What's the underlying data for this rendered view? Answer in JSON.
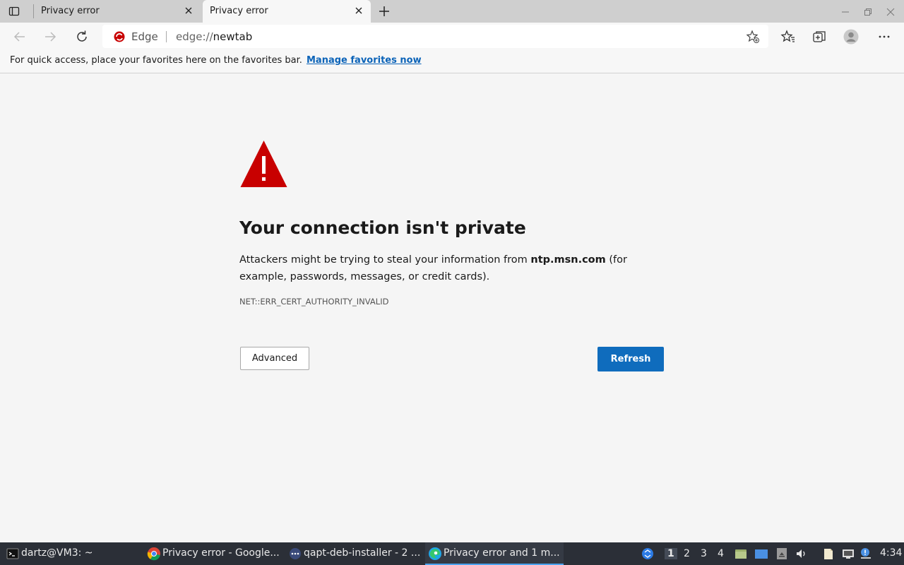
{
  "tabs": [
    {
      "title": "Privacy error",
      "active": false
    },
    {
      "title": "Privacy error",
      "active": true
    }
  ],
  "omnibox": {
    "label": "Edge",
    "url_scheme": "edge://",
    "url_host": "newtab"
  },
  "favorites_bar": {
    "message": "For quick access, place your favorites here on the favorites bar.",
    "link": "Manage favorites now"
  },
  "error_page": {
    "heading": "Your connection isn't private",
    "desc_before": "Attackers might be trying to steal your information from ",
    "desc_host": "ntp.msn.com",
    "desc_after": " (for example, passwords, messages, or credit cards).",
    "error_code": "NET::ERR_CERT_AUTHORITY_INVALID",
    "advanced_label": "Advanced",
    "refresh_label": "Refresh"
  },
  "taskbar": {
    "tasks": [
      {
        "label": "dartz@VM3: ~",
        "icon": "terminal-icon"
      },
      {
        "label": "Privacy error - Google...",
        "icon": "chrome-icon"
      },
      {
        "label": "qapt-deb-installer - 2 ...",
        "icon": "installer-icon"
      },
      {
        "label": "Privacy error and 1 m...",
        "icon": "edge-icon"
      }
    ],
    "workspaces": [
      "1",
      "2",
      "3",
      "4"
    ],
    "active_workspace": "1",
    "clock": "4:34"
  },
  "colors": {
    "accent": "#0f6cbd",
    "warning": "#c80000",
    "link": "#0b63b8"
  }
}
